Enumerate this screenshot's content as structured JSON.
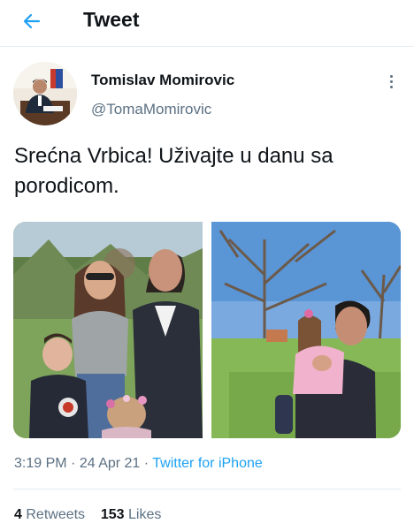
{
  "header": {
    "title": "Tweet",
    "back_icon": "arrow-left-icon",
    "accent": "#1da1f2"
  },
  "author": {
    "name": "Tomislav Momirovic",
    "handle": "@TomaMomirovic"
  },
  "tweet": {
    "text": "Srećna Vrbica! Uživajte u danu sa porodicom.",
    "time": "3:19 PM",
    "date": "24 Apr 21",
    "separator": "·",
    "source": "Twitter for iPhone",
    "photos": [
      "family-photo-1",
      "family-photo-2"
    ]
  },
  "stats": {
    "retweets_count": "4",
    "retweets_label": "Retweets",
    "likes_count": "153",
    "likes_label": "Likes"
  },
  "colors": {
    "text": "#0f1419",
    "secondary": "#5b7083",
    "link": "#1da1f2",
    "divider": "#e6ecf0"
  }
}
